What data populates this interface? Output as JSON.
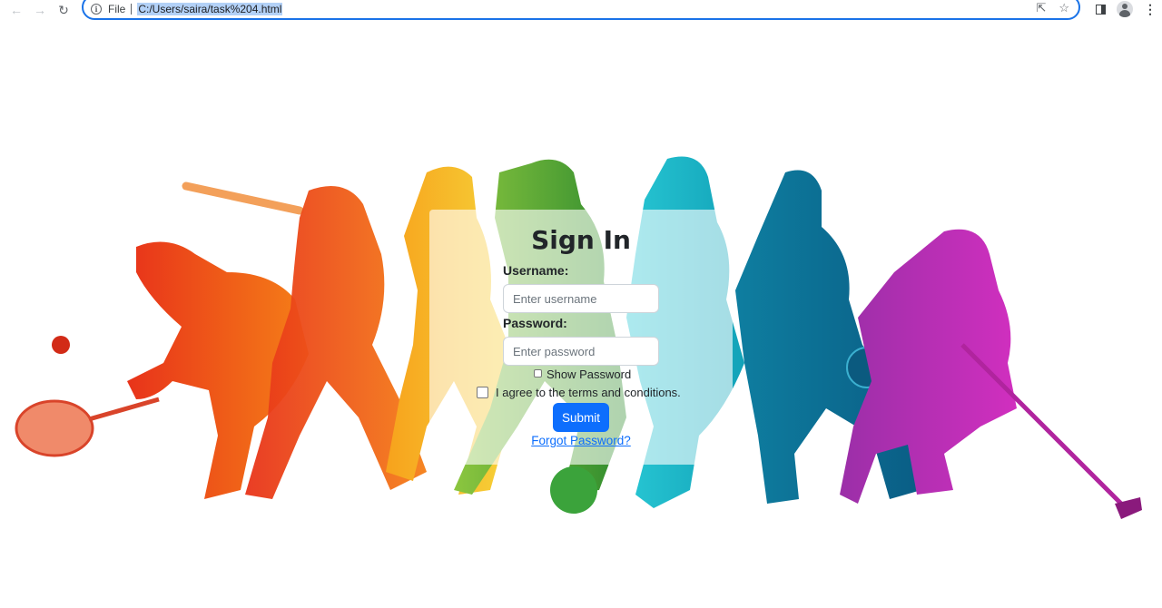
{
  "browser": {
    "scheme_label": "File",
    "url": "C:/Users/saira/task%204.html"
  },
  "form": {
    "title": "Sign In",
    "username_label": "Username:",
    "username_placeholder": "Enter username",
    "password_label": "Password:",
    "password_placeholder": "Enter password",
    "show_password_label": "Show Password",
    "terms_label": "I agree to the terms and conditions.",
    "submit_label": "Submit",
    "forgot_link": "Forgot Password?"
  },
  "colors": {
    "accent": "#0d6efd",
    "omnibox_border": "#1a73e8"
  },
  "background": {
    "image": "sports-silhouettes-polygon-art",
    "figures": [
      "tennis-player",
      "baseball-batter",
      "runner",
      "soccer-player",
      "basketball-player",
      "basketball-dribbler",
      "hockey-player"
    ]
  }
}
